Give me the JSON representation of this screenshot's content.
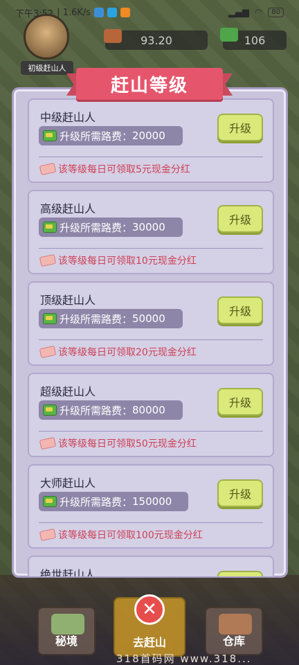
{
  "statusbar": {
    "time": "下午3:52",
    "speed": "| 1.6K/s",
    "battery": "80"
  },
  "hud": {
    "level_label": "初级赶山人",
    "currency_value": "93.20",
    "secondary_value": "106"
  },
  "modal": {
    "title": "赶山等级",
    "upgrade_label": "升级",
    "fee_prefix": "升级所需路费："
  },
  "levels": [
    {
      "name": "中级赶山人",
      "fee": "20000",
      "bonus": "该等级每日可领取5元现金分红"
    },
    {
      "name": "高级赶山人",
      "fee": "30000",
      "bonus": "该等级每日可领取10元现金分红"
    },
    {
      "name": "顶级赶山人",
      "fee": "50000",
      "bonus": "该等级每日可领取20元现金分红"
    },
    {
      "name": "超级赶山人",
      "fee": "80000",
      "bonus": "该等级每日可领取50元现金分红"
    },
    {
      "name": "大师赶山人",
      "fee": "150000",
      "bonus": "该等级每日可领取100元现金分红"
    },
    {
      "name": "绝世赶山人",
      "fee": "",
      "bonus": ""
    }
  ],
  "nav": {
    "left": "秘境",
    "center": "去赶山",
    "right": "仓库"
  },
  "watermark": "318首码网 www.318..."
}
